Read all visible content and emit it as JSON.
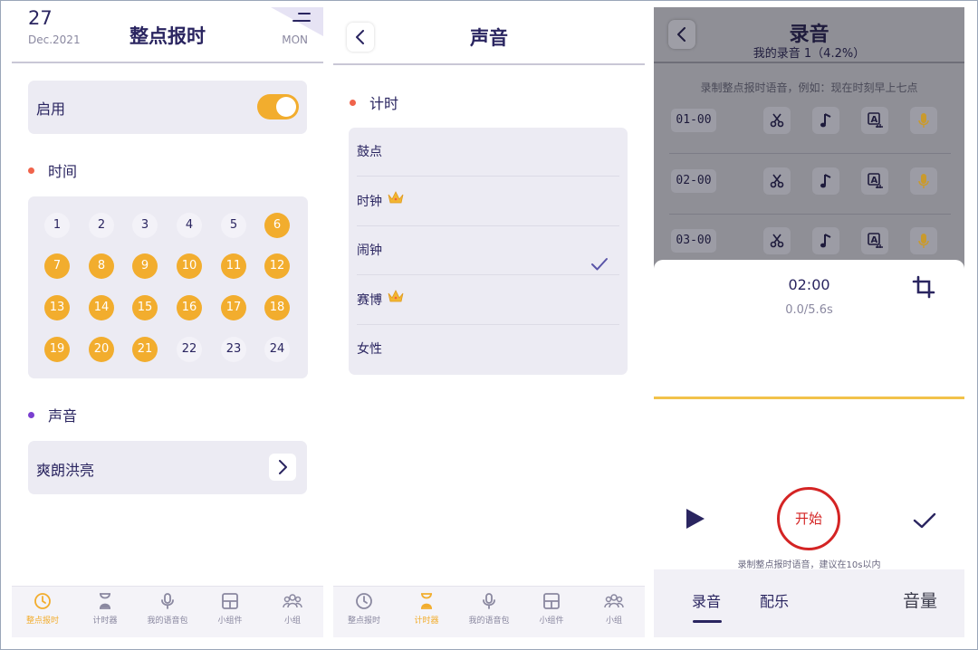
{
  "screen1": {
    "date_day": "27",
    "date_month": "Dec.2021",
    "title": "整点报时",
    "weekday": "MON",
    "enable_label": "启用",
    "enabled": true,
    "time_section": "时间",
    "hours": [
      {
        "label": "1",
        "on": false
      },
      {
        "label": "2",
        "on": false
      },
      {
        "label": "3",
        "on": false
      },
      {
        "label": "4",
        "on": false
      },
      {
        "label": "5",
        "on": false
      },
      {
        "label": "6",
        "on": true
      },
      {
        "label": "7",
        "on": true
      },
      {
        "label": "8",
        "on": true
      },
      {
        "label": "9",
        "on": true
      },
      {
        "label": "10",
        "on": true
      },
      {
        "label": "11",
        "on": true
      },
      {
        "label": "12",
        "on": true
      },
      {
        "label": "13",
        "on": true
      },
      {
        "label": "14",
        "on": true
      },
      {
        "label": "15",
        "on": true
      },
      {
        "label": "16",
        "on": true
      },
      {
        "label": "17",
        "on": true
      },
      {
        "label": "18",
        "on": true
      },
      {
        "label": "19",
        "on": true
      },
      {
        "label": "20",
        "on": true
      },
      {
        "label": "21",
        "on": true
      },
      {
        "label": "22",
        "on": false
      },
      {
        "label": "23",
        "on": false
      },
      {
        "label": "24",
        "on": false
      }
    ],
    "sound_section": "声音",
    "sound_value": "爽朗洪亮"
  },
  "tabbar": {
    "items": [
      {
        "label": "整点报时",
        "icon": "clock-icon"
      },
      {
        "label": "计时器",
        "icon": "hourglass-icon"
      },
      {
        "label": "我的语音包",
        "icon": "microphone-icon"
      },
      {
        "label": "小组件",
        "icon": "widget-icon"
      },
      {
        "label": "小组",
        "icon": "group-icon"
      }
    ]
  },
  "screen2": {
    "title": "声音",
    "section": "计时",
    "sounds": [
      {
        "label": "鼓点",
        "premium": false,
        "selected": false
      },
      {
        "label": "时钟",
        "premium": true,
        "selected": false
      },
      {
        "label": "闹钟",
        "premium": false,
        "selected": true
      },
      {
        "label": "赛博",
        "premium": true,
        "selected": false
      },
      {
        "label": "女性",
        "premium": false,
        "selected": false
      }
    ]
  },
  "screen3": {
    "title": "录音",
    "subtitle": "我的录音 1（4.2%）",
    "hint": "录制整点报时语音，例如：现在时刻早上七点",
    "rows": [
      {
        "time": "01-00"
      },
      {
        "time": "02-00"
      },
      {
        "time": "03-00"
      }
    ],
    "sheet_time": "02:00",
    "sheet_progress": "0.0/5.6s",
    "start_label": "开始",
    "tip": "录制整点报时语音，建议在10s以内",
    "tabs": [
      "录音",
      "配乐",
      "音量"
    ]
  },
  "colors": {
    "accent": "#f2ad2e",
    "navy": "#2a2560",
    "record_red": "#d42424",
    "dot_red": "#f0634b",
    "dot_purple": "#7a3fd0"
  }
}
